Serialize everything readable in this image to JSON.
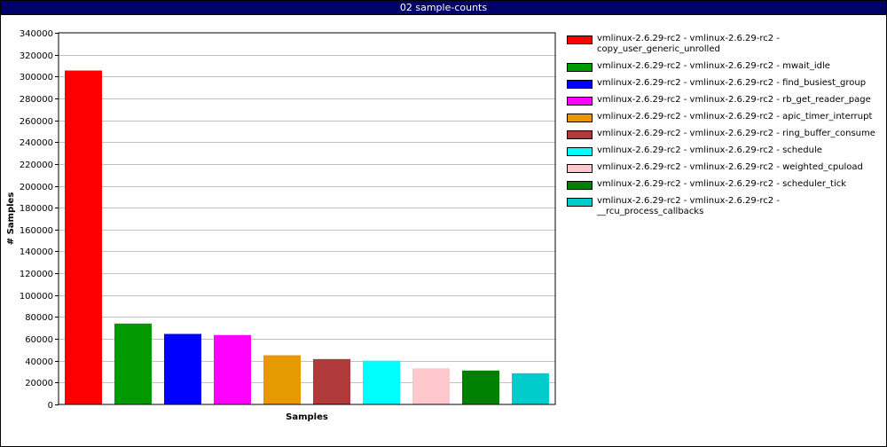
{
  "window": {
    "title": "02 sample-counts"
  },
  "chart_data": {
    "type": "bar",
    "title": "",
    "xlabel": "Samples",
    "ylabel": "# Samples",
    "ylim": [
      0,
      340000
    ],
    "yticks": [
      0,
      20000,
      40000,
      60000,
      80000,
      100000,
      120000,
      140000,
      160000,
      180000,
      200000,
      220000,
      240000,
      260000,
      280000,
      300000,
      320000,
      340000
    ],
    "grid": true,
    "legend_position": "right",
    "series": [
      {
        "name": "vmlinux-2.6.29-rc2 - vmlinux-2.6.29-rc2 - copy_user_generic_unrolled",
        "value": 305500,
        "color": "#ff0000"
      },
      {
        "name": "vmlinux-2.6.29-rc2 - vmlinux-2.6.29-rc2 - mwait_idle",
        "value": 74000,
        "color": "#009900"
      },
      {
        "name": "vmlinux-2.6.29-rc2 - vmlinux-2.6.29-rc2 - find_busiest_group",
        "value": 64500,
        "color": "#0000ff"
      },
      {
        "name": "vmlinux-2.6.29-rc2 - vmlinux-2.6.29-rc2 - rb_get_reader_page",
        "value": 63500,
        "color": "#ff00ff"
      },
      {
        "name": "vmlinux-2.6.29-rc2 - vmlinux-2.6.29-rc2 - apic_timer_interrupt",
        "value": 45000,
        "color": "#e69900"
      },
      {
        "name": "vmlinux-2.6.29-rc2 - vmlinux-2.6.29-rc2 - ring_buffer_consume",
        "value": 41500,
        "color": "#b03a3a"
      },
      {
        "name": "vmlinux-2.6.29-rc2 - vmlinux-2.6.29-rc2 - schedule",
        "value": 40000,
        "color": "#00ffff"
      },
      {
        "name": "vmlinux-2.6.29-rc2 - vmlinux-2.6.29-rc2 - weighted_cpuload",
        "value": 33000,
        "color": "#ffc8cc"
      },
      {
        "name": "vmlinux-2.6.29-rc2 - vmlinux-2.6.29-rc2 - scheduler_tick",
        "value": 31000,
        "color": "#007f00"
      },
      {
        "name": "vmlinux-2.6.29-rc2 - vmlinux-2.6.29-rc2 - __rcu_process_callbacks",
        "value": 28500,
        "color": "#00cccc"
      }
    ]
  }
}
